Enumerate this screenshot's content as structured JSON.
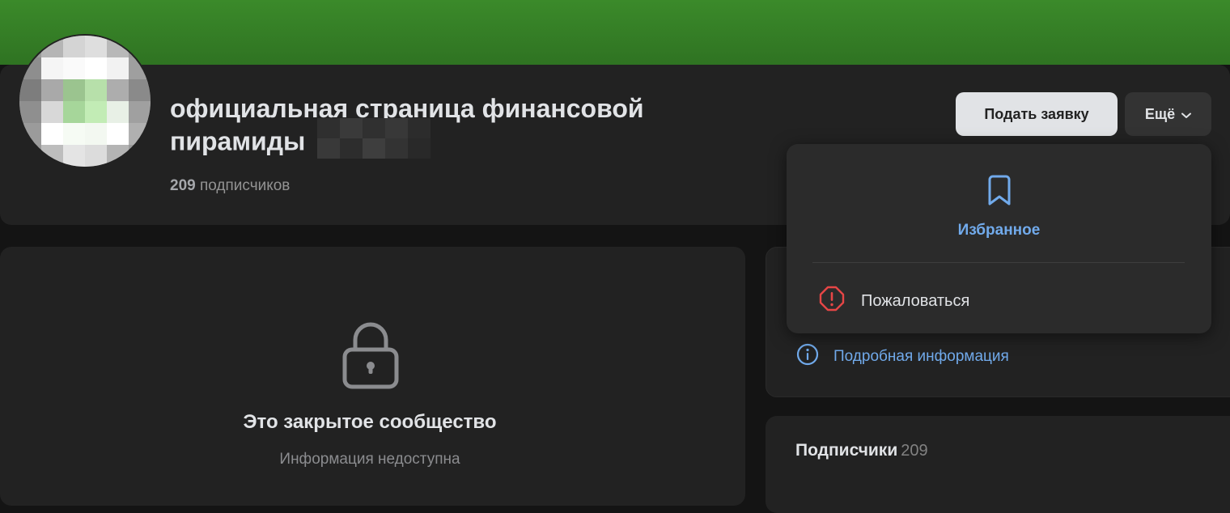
{
  "community": {
    "name": "официальная страница финансовой пирамиды",
    "subscribers_count": "209",
    "subscribers_label": "подписчиков"
  },
  "header": {
    "apply_button": "Подать заявку",
    "more_button": "Ещё"
  },
  "dropdown": {
    "favorites": "Избранное",
    "report": "Пожаловаться"
  },
  "closed": {
    "title": "Это закрытое сообщество",
    "subtitle": "Информация недоступна"
  },
  "side": {
    "details_link": "Подробная информация",
    "subscribers_title": "Подписчики",
    "subscribers_count": "209"
  },
  "colors": {
    "accent": "#71aaeb",
    "danger": "#e64646",
    "cover": "#2f7322"
  },
  "icons": [
    "bookmark-icon",
    "warning-icon",
    "info-icon",
    "lock-icon",
    "chevron-down-icon"
  ]
}
